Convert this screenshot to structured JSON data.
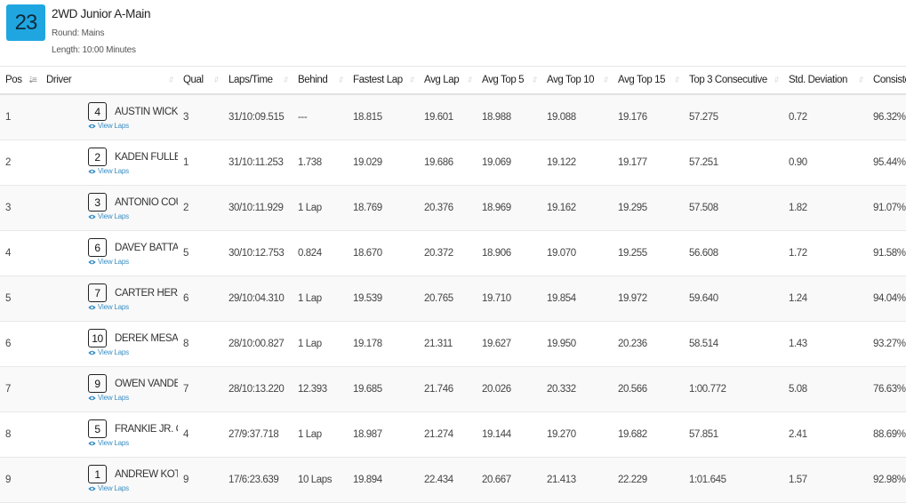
{
  "race": {
    "number": "23",
    "title": "2WD Junior A-Main",
    "round": "Round: Mains",
    "length": "Length: 10:00 Minutes"
  },
  "columns": [
    "Pos",
    "Driver",
    "Qual",
    "Laps/Time",
    "Behind",
    "Fastest Lap",
    "Avg Lap",
    "Avg Top 5",
    "Avg Top 10",
    "Avg Top 15",
    "Top 3 Consecutive",
    "Std. Deviation",
    "Consistency"
  ],
  "view_laps_label": "View Laps",
  "icons": {
    "sort": "sort-arrows-icon",
    "sort_active": "sort-numeric-asc-icon",
    "view": "eye-icon"
  },
  "colors": {
    "race_badge": "#1fa6e1",
    "link": "#3a8fc4"
  },
  "rows": [
    {
      "pos": "1",
      "car": "4",
      "driver": "AUSTIN WICK",
      "qual": "3",
      "laps": "31/10:09.515",
      "behind": "---",
      "fastest": "18.815",
      "avg": "19.601",
      "top5": "18.988",
      "top10": "19.088",
      "top15": "19.176",
      "top3c": "57.275",
      "std": "0.72",
      "cons": "96.32%"
    },
    {
      "pos": "2",
      "car": "2",
      "driver": "KADEN FULLER",
      "qual": "1",
      "laps": "31/10:11.253",
      "behind": "1.738",
      "fastest": "19.029",
      "avg": "19.686",
      "top5": "19.069",
      "top10": "19.122",
      "top15": "19.177",
      "top3c": "57.251",
      "std": "0.90",
      "cons": "95.44%"
    },
    {
      "pos": "3",
      "car": "3",
      "driver": "ANTONIO COUNSIL",
      "qual": "2",
      "laps": "30/10:11.929",
      "behind": "1 Lap",
      "fastest": "18.769",
      "avg": "20.376",
      "top5": "18.969",
      "top10": "19.162",
      "top15": "19.295",
      "top3c": "57.508",
      "std": "1.82",
      "cons": "91.07%"
    },
    {
      "pos": "4",
      "car": "6",
      "driver": "DAVEY BATTA",
      "qual": "5",
      "laps": "30/10:12.753",
      "behind": "0.824",
      "fastest": "18.670",
      "avg": "20.372",
      "top5": "18.906",
      "top10": "19.070",
      "top15": "19.255",
      "top3c": "56.608",
      "std": "1.72",
      "cons": "91.58%"
    },
    {
      "pos": "5",
      "car": "7",
      "driver": "CARTER HERASYMIUK",
      "qual": "6",
      "laps": "29/10:04.310",
      "behind": "1 Lap",
      "fastest": "19.539",
      "avg": "20.765",
      "top5": "19.710",
      "top10": "19.854",
      "top15": "19.972",
      "top3c": "59.640",
      "std": "1.24",
      "cons": "94.04%"
    },
    {
      "pos": "6",
      "car": "10",
      "driver": "DEREK MESA",
      "qual": "8",
      "laps": "28/10:00.827",
      "behind": "1 Lap",
      "fastest": "19.178",
      "avg": "21.311",
      "top5": "19.627",
      "top10": "19.950",
      "top15": "20.236",
      "top3c": "58.514",
      "std": "1.43",
      "cons": "93.27%"
    },
    {
      "pos": "7",
      "car": "9",
      "driver": "OWEN VANDERBEEK",
      "qual": "7",
      "laps": "28/10:13.220",
      "behind": "12.393",
      "fastest": "19.685",
      "avg": "21.746",
      "top5": "20.026",
      "top10": "20.332",
      "top15": "20.566",
      "top3c": "1:00.772",
      "std": "5.08",
      "cons": "76.63%"
    },
    {
      "pos": "8",
      "car": "5",
      "driver": "FRANKIE JR. CONTRERAS",
      "qual": "4",
      "laps": "27/9:37.718",
      "behind": "1 Lap",
      "fastest": "18.987",
      "avg": "21.274",
      "top5": "19.144",
      "top10": "19.270",
      "top15": "19.682",
      "top3c": "57.851",
      "std": "2.41",
      "cons": "88.69%"
    },
    {
      "pos": "9",
      "car": "1",
      "driver": "ANDREW KOTHMAN",
      "qual": "9",
      "laps": "17/6:23.639",
      "behind": "10 Laps",
      "fastest": "19.894",
      "avg": "22.434",
      "top5": "20.667",
      "top10": "21.413",
      "top15": "22.229",
      "top3c": "1:01.645",
      "std": "1.57",
      "cons": "92.98%"
    }
  ]
}
